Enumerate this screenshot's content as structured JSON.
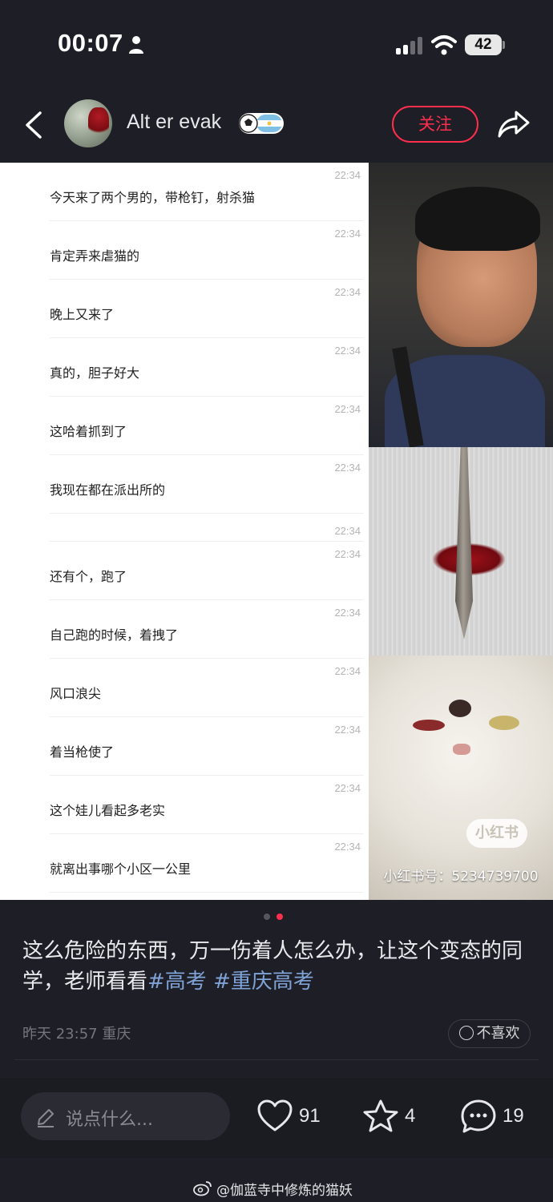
{
  "status_bar": {
    "time": "00:07",
    "battery": "42",
    "icons": [
      "person-icon",
      "signal-icon",
      "wifi-icon",
      "battery-icon"
    ]
  },
  "header": {
    "back_icon": "chevron-left-icon",
    "username": "Alt er evak",
    "badge_icon": "soccer-argentina-badge-icon",
    "follow_label": "关注",
    "share_icon": "share-arrow-icon"
  },
  "chat_messages": [
    {
      "time": "22:34",
      "text": "今天来了两个男的，带枪钉，射杀猫"
    },
    {
      "time": "22:34",
      "text": "肯定弄来虐猫的"
    },
    {
      "time": "22:34",
      "text": "晚上又来了"
    },
    {
      "time": "22:34",
      "text": "真的，胆子好大"
    },
    {
      "time": "22:34",
      "text": "这哈着抓到了"
    },
    {
      "time": "22:34",
      "text": "我现在都在派出所的"
    },
    {
      "time": "22:34",
      "text": ""
    },
    {
      "time": "22:34",
      "text": "还有个，跑了"
    },
    {
      "time": "22:34",
      "text": "自己跑的时候，着拽了"
    },
    {
      "time": "22:34",
      "text": "风口浪尖"
    },
    {
      "time": "22:34",
      "text": "着当枪使了"
    },
    {
      "time": "22:34",
      "text": "这个娃儿看起多老实"
    },
    {
      "time": "22:34",
      "text": "就离出事哪个小区一公里"
    }
  ],
  "media_watermark": {
    "logo": "小红书",
    "id_text": "小红书号：5234739700"
  },
  "carousel": {
    "total": 2,
    "current": 2
  },
  "post": {
    "caption_text": "这么危险的东西，万一伤着人怎么办，让这个变态的同学，老师看看",
    "tags": [
      "#高考",
      "#重庆高考"
    ],
    "meta": "昨天 23:57 重庆",
    "dislike_label": "不喜欢"
  },
  "bottom_bar": {
    "comment_placeholder": "说点什么...",
    "likes": "91",
    "favorites": "4",
    "comments": "19"
  },
  "footer_watermark": "@伽蓝寺中修炼的猫妖",
  "colors": {
    "background": "#1e1e26",
    "accent": "#ff2e4d",
    "hashtag": "#7fa3d6"
  }
}
